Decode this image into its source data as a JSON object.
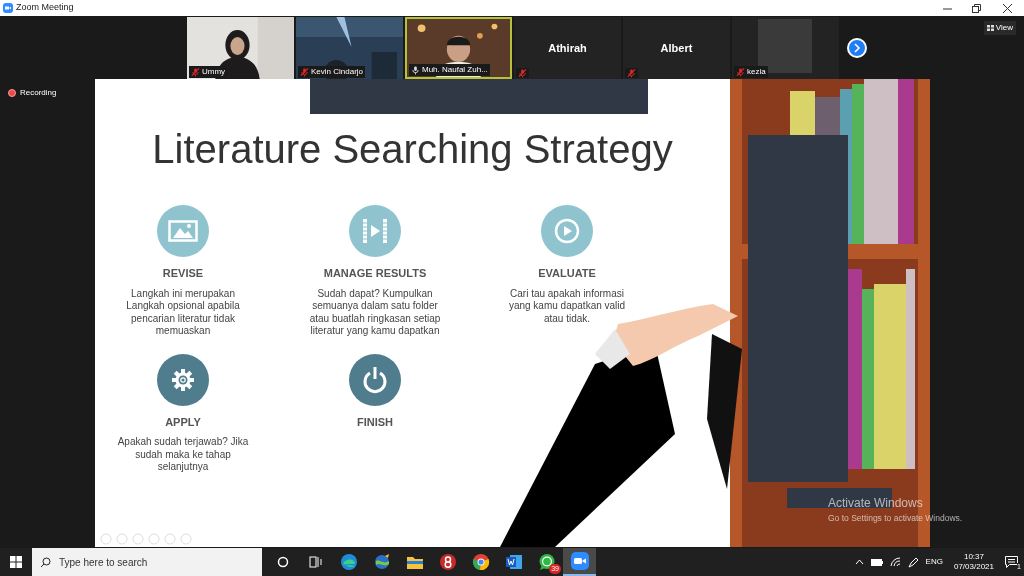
{
  "window": {
    "title": "Zoom Meeting"
  },
  "participants": [
    {
      "name": "Ummy",
      "kind": "video",
      "muted": true,
      "speaking": false
    },
    {
      "name": "Kevin Cindarjo",
      "kind": "video",
      "muted": true,
      "speaking": false
    },
    {
      "name": "Muh. Naufal Zuh...",
      "kind": "video",
      "muted": false,
      "speaking": true
    },
    {
      "name": "Athirah",
      "kind": "name",
      "muted": true,
      "speaking": false
    },
    {
      "name": "Albert",
      "kind": "name",
      "muted": true,
      "speaking": false
    },
    {
      "name": "kezia",
      "kind": "avatar",
      "muted": true,
      "speaking": false
    }
  ],
  "view_button": "View",
  "recording": "Recording",
  "slide": {
    "title": "Literature Searching Strategy",
    "steps": [
      {
        "color": "#8fc4cf",
        "label": "REVISE",
        "text": "Langkah ini merupakan Langkah opsional apabila pencarian literatur tidak memuaskan"
      },
      {
        "color": "#8fc4cf",
        "label": "MANAGE RESULTS",
        "text": "Sudah dapat? Kumpulkan semuanya dalam satu folder atau buatlah ringkasan setiap literatur yang kamu dapatkan"
      },
      {
        "color": "#8fc4cf",
        "label": "EVALUATE",
        "text": "Cari tau apakah informasi yang kamu dapatkan valid atau tidak."
      },
      {
        "color": "#4f7d8d",
        "label": "APPLY",
        "text": "Apakah sudah terjawab? Jika sudah maka ke tahap selanjutnya"
      },
      {
        "color": "#4f7d8d",
        "label": "FINISH"
      }
    ]
  },
  "activation": {
    "title": "Activate Windows",
    "subtitle": "Go to Settings to activate Windows."
  },
  "taskbar": {
    "search_placeholder": "Type here to search",
    "apps": [
      {
        "kind": "cortana",
        "active": false
      },
      {
        "kind": "taskview",
        "active": false
      },
      {
        "kind": "edge",
        "active": false
      },
      {
        "kind": "globe",
        "active": false
      },
      {
        "kind": "folder",
        "active": false
      },
      {
        "kind": "red",
        "active": false
      },
      {
        "kind": "chrome",
        "active": false
      },
      {
        "kind": "word",
        "active": false
      },
      {
        "kind": "whatsapp",
        "active": false,
        "badge": "39"
      },
      {
        "kind": "zoom",
        "active": true
      }
    ],
    "language": "ENG",
    "time": "10:37",
    "date": "07/03/2021",
    "notifications": "1"
  }
}
